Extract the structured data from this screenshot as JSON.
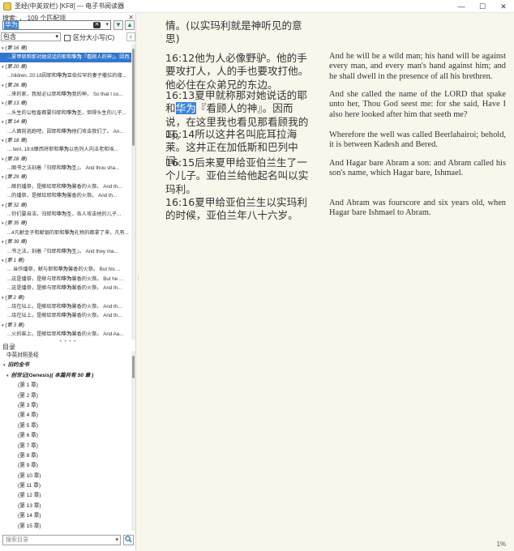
{
  "window": {
    "title": "圣经(中英双栏)  [KF8] — 电子书阅读器",
    "buttons": [
      "—",
      "☐",
      "✕"
    ]
  },
  "search": {
    "status_label": "搜索: ， 109 个匹配项",
    "query": "华为",
    "mode": "包含",
    "case_label": "区分大小写(C)"
  },
  "results": [
    {
      "t": "h",
      "text": "(第 16 章)"
    },
    {
      "t": "r",
      "sel": true,
      "pre": "...夏甲就称那对她说话的耶和",
      "hit": "华为",
      "post": "『看顾人的神』。因而..."
    },
    {
      "t": "h",
      "text": "(第 20 章)"
    },
    {
      "t": "r",
      "pre": "...hildren. 20:18因耶和",
      "hit": "华为",
      "post": "亚伯拉罕的妻子撒拉的缘..."
    },
    {
      "t": "h",
      "text": "(第 26 章)"
    },
    {
      "t": "r",
      "pre": "...来的家，我就必以耶和",
      "hit": "华为",
      "post": "我的神， So that I co..."
    },
    {
      "t": "h",
      "text": "(第 13 章)"
    },
    {
      "t": "r",
      "pre": "...头生的公牲畜都要归耶和",
      "hit": "华为",
      "post": "圣，但得头生的儿子..."
    },
    {
      "t": "h",
      "text": "(第 14 章)"
    },
    {
      "t": "r",
      "pre": "...人面前逃跑吧，因耶和",
      "hit": "华为",
      "post": "他们攻击我们了。 An..."
    },
    {
      "t": "h",
      "text": "(第 18 章)"
    },
    {
      "t": "r",
      "pre": "... tent. 18:8摩西将耶和",
      "hit": "华为",
      "post": "以色列人向法老和埃..."
    },
    {
      "t": "h",
      "text": "(第 28 章)"
    },
    {
      "t": "r",
      "pre": "...图书之法刻着『归耶和",
      "hit": "华为",
      "post": "圣』。 And thou sha..."
    },
    {
      "t": "h",
      "text": "(第 29 章)"
    },
    {
      "t": "r",
      "pre": "...献的燔祭，是献给耶和",
      "hit": "华为",
      "post": "馨香的火祭。 And th..."
    },
    {
      "t": "r",
      "pre": "...的燔祭，是献给耶和",
      "hit": "华为",
      "post": "馨香的火祭。 And th..."
    },
    {
      "t": "h",
      "text": "(第 32 章)"
    },
    {
      "t": "r",
      "pre": "...你们要自洁，归耶和",
      "hit": "华为",
      "post": "圣，各人攻击他的儿子..."
    },
    {
      "t": "h",
      "text": "(第 35 章)"
    },
    {
      "t": "r",
      "pre": "...4凡献金子和献银的耶和",
      "hit": "华为",
      "post": "礼物的都拿了来，凡有..."
    },
    {
      "t": "h",
      "text": "(第 39 章)"
    },
    {
      "t": "r",
      "pre": "...书之法，刻着『归耶和",
      "hit": "华为",
      "post": "圣』。 And they ma..."
    },
    {
      "t": "h",
      "text": "(第 1 章)"
    },
    {
      "t": "r",
      "pre": "... 当作燔祭，献与耶和",
      "hit": "华为",
      "post": "馨香的火祭。 But his ..."
    },
    {
      "t": "r",
      "pre": "...这是燔祭，是献与耶和",
      "hit": "华为",
      "post": "馨香的火祭。 But he ..."
    },
    {
      "t": "r",
      "pre": "...这是燔祭，是献与耶和",
      "hit": "华为",
      "post": "馨香的火祭。 And th..."
    },
    {
      "t": "h",
      "text": "(第 2 章)"
    },
    {
      "t": "r",
      "pre": "...烧在坛上，是献给耶和",
      "hit": "华为",
      "post": "馨香的火祭。 And th..."
    },
    {
      "t": "r",
      "pre": "...烧在坛上，是献给耶和",
      "hit": "华为",
      "post": "馨香的火祭。 And th..."
    },
    {
      "t": "h",
      "text": "(第 3 章)"
    },
    {
      "t": "r",
      "pre": "...火的柴上，是献给耶和",
      "hit": "华为",
      "post": "馨香的火祭。 And Aa..."
    },
    {
      "t": "r",
      "pre": "...坛上焚烧，是献给耶和",
      "hit": "华为",
      "post": "食物的火祭。 And th..."
    },
    {
      "t": "r",
      "pre": "... 一概取下，都献给耶和",
      "hit": "华为",
      "post": "馨香的火祭。 And the two ..."
    },
    {
      "t": "h",
      "text": "(第 4 章)"
    },
    {
      "t": "r",
      "pre": "...独的公牛犊献给耶和",
      "hit": "华为",
      "post": "赎罪祭。 If the priest..."
    },
    {
      "t": "h",
      "text": "(第 6 章)"
    },
    {
      "t": "r",
      "pre": "...烧在坛上，单给耶和",
      "hit": "华为",
      "post": "馨香的火祭作为纪念。 An..."
    },
    {
      "t": "r",
      "pre": "...了分成块子，献给耶和",
      "hit": "华为",
      "post": "馨香的火祭，作为纪念。 In a pa..."
    },
    {
      "t": "h",
      "text": "(第 7 章)"
    },
    {
      "t": "r",
      "pre": "...要把一个供献给耶和",
      "hit": "华为",
      "post": "举祭，是要归给洒平安..."
    }
  ],
  "toc": {
    "title": "目录",
    "rows": [
      {
        "lv": 0,
        "text": "中英对照圣经"
      },
      {
        "lv": 1,
        "text": "旧约全书"
      },
      {
        "lv": 2,
        "text": "创世记(Genesis)( 本篇共有 50 章 )"
      },
      {
        "lv": 3,
        "text": "(第 1 章)"
      },
      {
        "lv": 3,
        "text": "(第 2 章)"
      },
      {
        "lv": 3,
        "text": "(第 3 章)"
      },
      {
        "lv": 3,
        "text": "(第 4 章)"
      },
      {
        "lv": 3,
        "text": "(第 5 章)"
      },
      {
        "lv": 3,
        "text": "(第 6 章)"
      },
      {
        "lv": 3,
        "text": "(第 7 章)"
      },
      {
        "lv": 3,
        "text": "(第 8 章)"
      },
      {
        "lv": 3,
        "text": "(第 9 章)"
      },
      {
        "lv": 3,
        "text": "(第 10 章)"
      },
      {
        "lv": 3,
        "text": "(第 11 章)"
      },
      {
        "lv": 3,
        "text": "(第 12 章)"
      },
      {
        "lv": 3,
        "text": "(第 13 章)"
      },
      {
        "lv": 3,
        "text": "(第 14 章)"
      },
      {
        "lv": 3,
        "text": "(第 15 章)"
      }
    ],
    "search_placeholder": "搜索目录"
  },
  "reader": {
    "cn": [
      {
        "pre": "情。(以实玛利就是神听见的意思)"
      },
      {
        "pre": "16:12他为人必像野驴。他的手要攻打人，人的手也要攻打他。他必住在众弟兄的东边。"
      },
      {
        "pre": "16:13夏甲就称那对她说话的耶和",
        "hl": "华为",
        "post": "『看顾人的神』。因而说，在这里我也看见那看顾我的吗。"
      },
      {
        "pre": "16:14所以这井名叫庇耳拉海莱。这井正在加低斯和巴列中间。"
      },
      {
        "pre": "16:15后来夏甲给亚伯兰生了一个儿子。亚伯兰给他起名叫以实玛利。"
      },
      {
        "pre": "16:16夏甲给亚伯兰生以实玛利的时候，亚伯兰年八十六岁。"
      }
    ],
    "en": [
      "And he will be a wild man; his hand will be against every man, and every man's hand against him; and he shall dwell in the presence of all his brethren.",
      "And she called the name of the LORD that spake unto her, Thou God seest me: for she said, Have I also here looked after him that seeth me?",
      "Wherefore the well was called Beerlahairoi; behold, it is between Kadesh and Bered.",
      "And Hagar bare Abram a son: and Abram called his son's name, which Hagar bare, Ishmael.",
      "And Abram was fourscore and six years old, when Hagar bare Ishmael to Abram."
    ],
    "progress": "1%"
  }
}
